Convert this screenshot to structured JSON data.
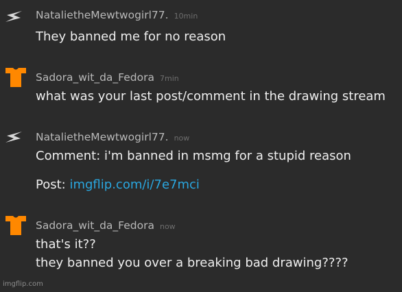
{
  "comments": [
    {
      "avatar": "lightning-bolt-icon",
      "username": "NatalietheMewtwogirl77.",
      "time": "10min",
      "lines": [
        "They banned me for no reason"
      ]
    },
    {
      "avatar": "orange-tshirt-icon",
      "username": "Sadora_wit_da_Fedora",
      "time": "7min",
      "lines": [
        "what was your last post/comment in the drawing stream"
      ]
    },
    {
      "avatar": "lightning-bolt-icon",
      "username": "NatalietheMewtwogirl77.",
      "time": "now",
      "lines": [
        "Comment: i'm banned in msmg for a stupid reason"
      ],
      "post_label": "Post:",
      "post_link": "imgflip.com/i/7e7mci"
    },
    {
      "avatar": "orange-tshirt-icon",
      "username": "Sadora_wit_da_Fedora",
      "time": "now",
      "lines": [
        "that's it??",
        "they banned you over a breaking bad drawing????"
      ]
    }
  ],
  "watermark": "imgflip.com",
  "colors": {
    "background": "#2b2b2b",
    "username": "#b9b9b9",
    "timestamp": "#6e6e6e",
    "text": "#efefef",
    "link": "#2aa7e0",
    "shirt_avatar": "#ff8800"
  }
}
